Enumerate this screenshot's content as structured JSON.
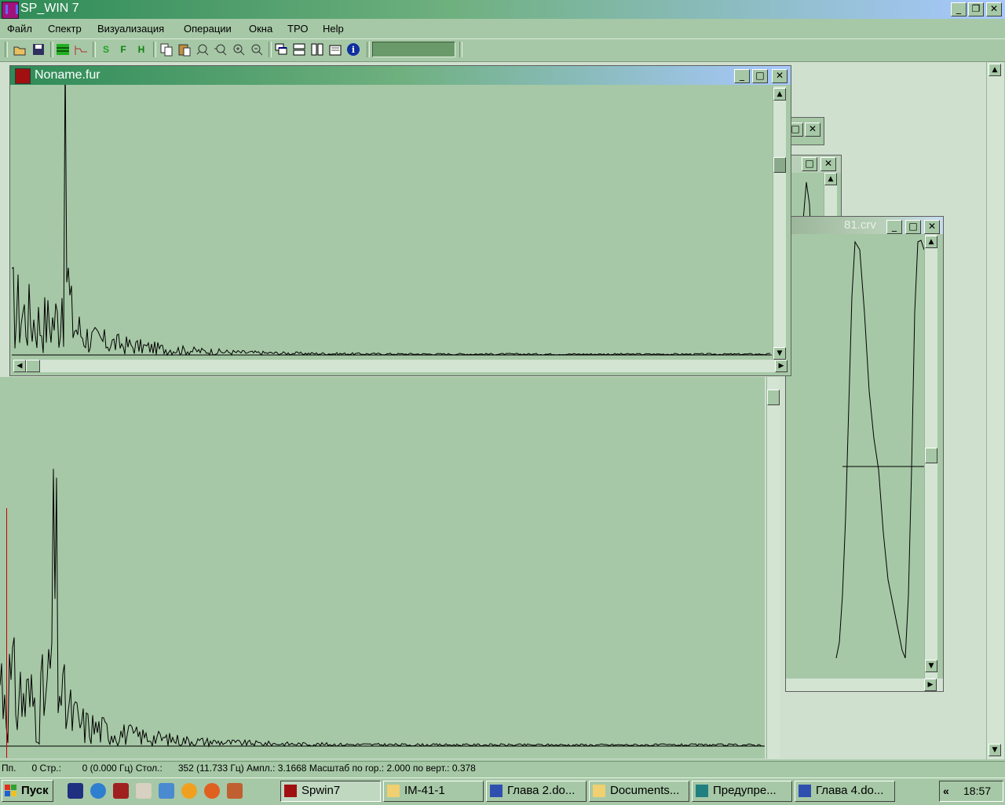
{
  "app": {
    "title": "SP_WIN 7"
  },
  "menu": [
    "Файл",
    "Спектр",
    "Визуализация",
    "Операции",
    "Окна",
    "ТРО",
    "Help"
  ],
  "toolbar": {
    "buttons": [
      "open-icon",
      "save-icon",
      "spectrum-grid-icon",
      "filter-icon",
      "s-icon",
      "f-icon",
      "h-icon",
      "copy-icon",
      "paste-icon",
      "zoom-fit-icon",
      "zoom-x-icon",
      "zoom-in-icon",
      "zoom-out-icon",
      "cascade-icon",
      "tile-horizontal-icon",
      "tile-vertical-icon",
      "settings-icon",
      "info-icon"
    ],
    "letters": {
      "s": "S",
      "f": "F",
      "h": "H",
      "info": "i"
    },
    "progress": 0
  },
  "windows": {
    "main": {
      "title": "Noname.fur"
    },
    "back_right": {
      "title_fragment": "81.crv"
    }
  },
  "status": {
    "text": "Пп.      0 Стр.:        0 (0.000 Гц) Стол.:      352 (11.733 Гц) Ампл.: 3.1668 Масштаб по гор.: 2.000 по верт.: 0.378"
  },
  "taskbar": {
    "start_label": "Пуск",
    "tasks": [
      {
        "label": "Spwin7",
        "active": true
      },
      {
        "label": "IM-41-1",
        "active": false
      },
      {
        "label": "Глава 2.do...",
        "active": false
      },
      {
        "label": "Documents...",
        "active": false
      },
      {
        "label": "Предупре...",
        "active": false
      },
      {
        "label": "Глава 4.do...",
        "active": false
      }
    ],
    "tray_chevron": "«",
    "clock": "18:57"
  },
  "colors": {
    "desktop": "#a6c8a6",
    "title_active": "#2e8b57",
    "marker": "#cc0000"
  }
}
